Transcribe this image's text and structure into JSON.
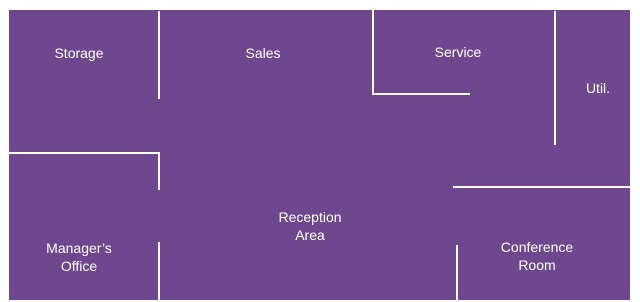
{
  "floorplan": {
    "colors": {
      "floor": "#6e478f",
      "wall": "#ffffff",
      "label": "#ffffff"
    },
    "rooms": [
      {
        "id": "storage",
        "lines": [
          "Storage"
        ]
      },
      {
        "id": "sales",
        "lines": [
          "Sales"
        ]
      },
      {
        "id": "service",
        "lines": [
          "Service"
        ]
      },
      {
        "id": "util",
        "lines": [
          "Util."
        ]
      },
      {
        "id": "reception",
        "lines": [
          "Reception",
          "Area"
        ]
      },
      {
        "id": "managers-office",
        "lines": [
          "Manager’s",
          "Office"
        ]
      },
      {
        "id": "conference",
        "lines": [
          "Conference",
          "Room"
        ]
      }
    ]
  }
}
